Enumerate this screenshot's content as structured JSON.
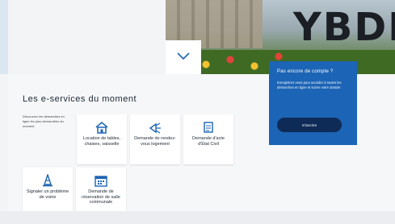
{
  "hero": {
    "monument_text": "YBDE"
  },
  "eservices": {
    "title": "Les e-services du moment",
    "intro": "Découvrez les démarches en ligne les plus demandées du moment",
    "tiles": [
      {
        "icon": "house-icon",
        "label": "Location de tables, chaises, vaisselle"
      },
      {
        "icon": "megaphone-icon",
        "label": "Demande de rendez-vous logement"
      },
      {
        "icon": "document-icon",
        "label": "Demande d'acte d'État Civil"
      },
      {
        "icon": "cone-icon",
        "label": "Signaler un problème de voirie"
      },
      {
        "icon": "calendar-icon",
        "label": "Demande de réservation de salle communale"
      }
    ]
  },
  "promo": {
    "title": "Pas encore de compte ?",
    "text": "Enregistrez-vous pour accéder à toutes les démarches en ligne et suivre votre dossier",
    "button": "S'inscrire"
  },
  "colors": {
    "accent": "#1c64b5",
    "button_dark": "#0e2b57",
    "icon": "#1c64b5"
  }
}
